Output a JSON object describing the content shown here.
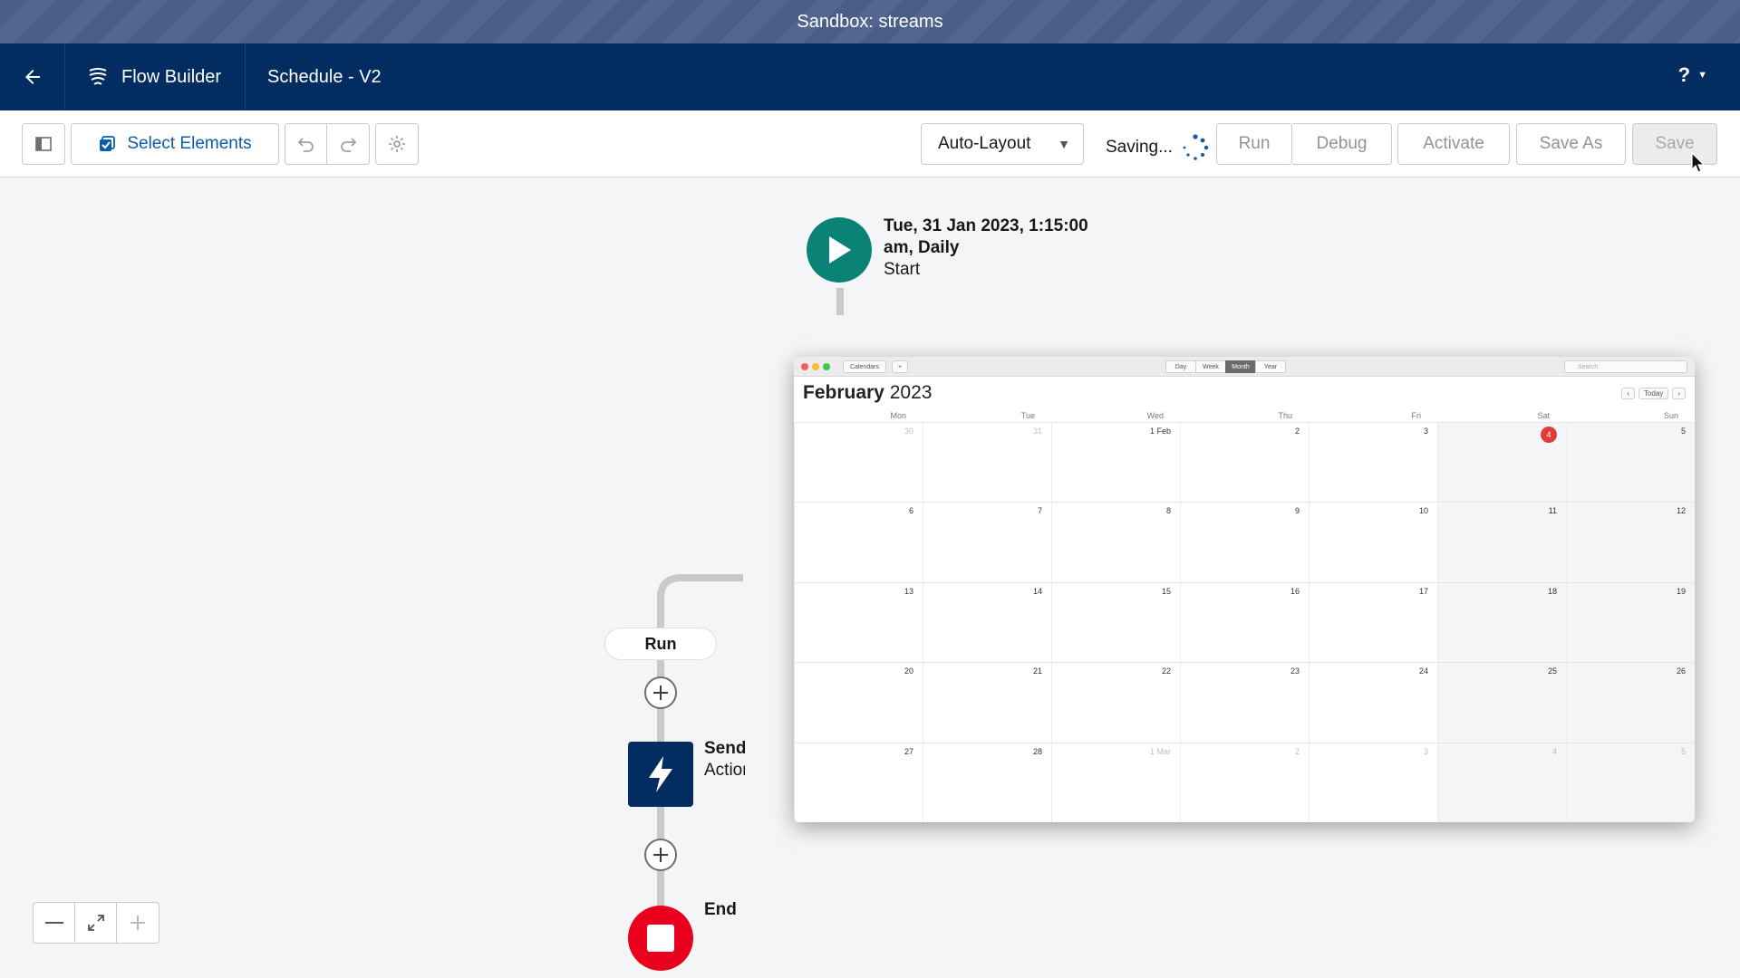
{
  "sandbox": {
    "label": "Sandbox: streams"
  },
  "header": {
    "back_icon": "arrow-left-icon",
    "app_icon": "flow-icon",
    "app_name": "Flow Builder",
    "flow_title": "Schedule - V2",
    "help_label": "?"
  },
  "toolbar": {
    "toggle_panel_icon": "panel-icon",
    "select_elements_label": "Select Elements",
    "undo_icon": "undo-icon",
    "redo_icon": "redo-icon",
    "settings_icon": "gear-icon",
    "layout_select": "Auto-Layout",
    "saving_label": "Saving...",
    "run_label": "Run",
    "debug_label": "Debug",
    "activate_label": "Activate",
    "save_as_label": "Save As",
    "save_label": "Save"
  },
  "canvas": {
    "start_schedule": "Tue, 31 Jan 2023, 1:15:00 am, Daily",
    "start_label": "Start",
    "run_path_label": "Run",
    "action_line1": "Send",
    "action_line2": "Action",
    "end_label": "End"
  },
  "zoom": {
    "zoom_out": "minus-icon",
    "fit": "fit-icon",
    "zoom_in": "plus-icon"
  },
  "calendar": {
    "chip_calendars": "Calendars",
    "chip_add": "+",
    "views": [
      "Day",
      "Week",
      "Month",
      "Year"
    ],
    "active_view": "Month",
    "search_placeholder": "Search",
    "month": "February",
    "year": "2023",
    "today_label": "Today",
    "weekdays": [
      "Mon",
      "Tue",
      "Wed",
      "Thu",
      "Fri",
      "Sat",
      "Sun"
    ],
    "today_day": "4",
    "weeks": [
      [
        "30",
        "31",
        "1 Feb",
        "2",
        "3",
        "4",
        "5"
      ],
      [
        "6",
        "7",
        "8",
        "9",
        "10",
        "11",
        "12"
      ],
      [
        "13",
        "14",
        "15",
        "16",
        "17",
        "18",
        "19"
      ],
      [
        "20",
        "21",
        "22",
        "23",
        "24",
        "25",
        "26"
      ],
      [
        "27",
        "28",
        "1 Mar",
        "2",
        "3",
        "4",
        "5"
      ]
    ],
    "muted_cells": [
      "0-0",
      "0-1",
      "4-2",
      "4-3",
      "4-4",
      "4-5",
      "4-6"
    ]
  },
  "colors": {
    "header_bg": "#032d60",
    "start_green": "#0b8276",
    "end_red": "#ea001e",
    "accent_blue": "#0b5cab"
  }
}
